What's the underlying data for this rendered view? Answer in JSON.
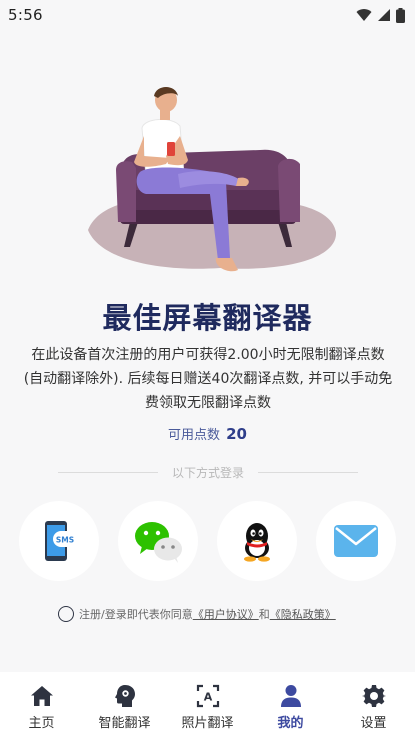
{
  "status_bar": {
    "time": "5:56",
    "icons": [
      "wifi-icon",
      "signal-icon",
      "battery-icon"
    ]
  },
  "hero": {
    "illustration": "person-on-sofa-illustration"
  },
  "title": "最佳屏幕翻译器",
  "description": "在此设备首次注册的用户可获得2.00小时无限制翻译点数(自动翻译除外). 后续每日赠送40次翻译点数, 并可以手动免费领取无限翻译点数",
  "points": {
    "label": "可用点数",
    "value": "20"
  },
  "login": {
    "divider_text": "以下方式登录",
    "methods": [
      {
        "name": "sms",
        "icon": "sms-phone-icon",
        "badge": "SMS"
      },
      {
        "name": "wechat",
        "icon": "wechat-icon"
      },
      {
        "name": "qq",
        "icon": "qq-icon"
      },
      {
        "name": "email",
        "icon": "email-icon"
      }
    ]
  },
  "agreement": {
    "checked": false,
    "prefix": "注册/登录即代表你同意",
    "user_agreement": "《用户协议》",
    "and": "和",
    "privacy_policy": "《隐私政策》"
  },
  "tabbar": {
    "active_index": 3,
    "active_color": "#3d4aa0",
    "tabs": [
      {
        "label": "主页",
        "icon": "home-icon"
      },
      {
        "label": "智能翻译",
        "icon": "smart-translate-icon"
      },
      {
        "label": "照片翻译",
        "icon": "photo-translate-icon"
      },
      {
        "label": "我的",
        "icon": "profile-icon"
      },
      {
        "label": "设置",
        "icon": "settings-gear-icon"
      }
    ]
  }
}
